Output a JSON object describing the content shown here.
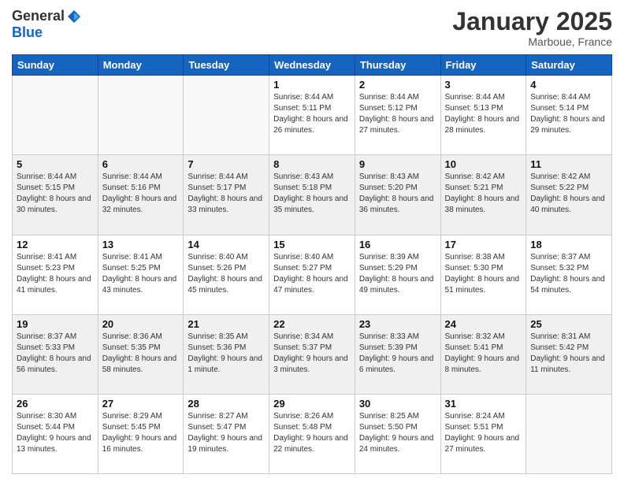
{
  "header": {
    "logo_general": "General",
    "logo_blue": "Blue",
    "month": "January 2025",
    "location": "Marboue, France"
  },
  "days_of_week": [
    "Sunday",
    "Monday",
    "Tuesday",
    "Wednesday",
    "Thursday",
    "Friday",
    "Saturday"
  ],
  "weeks": [
    [
      {
        "day": "",
        "info": ""
      },
      {
        "day": "",
        "info": ""
      },
      {
        "day": "",
        "info": ""
      },
      {
        "day": "1",
        "info": "Sunrise: 8:44 AM\nSunset: 5:11 PM\nDaylight: 8 hours and 26 minutes."
      },
      {
        "day": "2",
        "info": "Sunrise: 8:44 AM\nSunset: 5:12 PM\nDaylight: 8 hours and 27 minutes."
      },
      {
        "day": "3",
        "info": "Sunrise: 8:44 AM\nSunset: 5:13 PM\nDaylight: 8 hours and 28 minutes."
      },
      {
        "day": "4",
        "info": "Sunrise: 8:44 AM\nSunset: 5:14 PM\nDaylight: 8 hours and 29 minutes."
      }
    ],
    [
      {
        "day": "5",
        "info": "Sunrise: 8:44 AM\nSunset: 5:15 PM\nDaylight: 8 hours and 30 minutes."
      },
      {
        "day": "6",
        "info": "Sunrise: 8:44 AM\nSunset: 5:16 PM\nDaylight: 8 hours and 32 minutes."
      },
      {
        "day": "7",
        "info": "Sunrise: 8:44 AM\nSunset: 5:17 PM\nDaylight: 8 hours and 33 minutes."
      },
      {
        "day": "8",
        "info": "Sunrise: 8:43 AM\nSunset: 5:18 PM\nDaylight: 8 hours and 35 minutes."
      },
      {
        "day": "9",
        "info": "Sunrise: 8:43 AM\nSunset: 5:20 PM\nDaylight: 8 hours and 36 minutes."
      },
      {
        "day": "10",
        "info": "Sunrise: 8:42 AM\nSunset: 5:21 PM\nDaylight: 8 hours and 38 minutes."
      },
      {
        "day": "11",
        "info": "Sunrise: 8:42 AM\nSunset: 5:22 PM\nDaylight: 8 hours and 40 minutes."
      }
    ],
    [
      {
        "day": "12",
        "info": "Sunrise: 8:41 AM\nSunset: 5:23 PM\nDaylight: 8 hours and 41 minutes."
      },
      {
        "day": "13",
        "info": "Sunrise: 8:41 AM\nSunset: 5:25 PM\nDaylight: 8 hours and 43 minutes."
      },
      {
        "day": "14",
        "info": "Sunrise: 8:40 AM\nSunset: 5:26 PM\nDaylight: 8 hours and 45 minutes."
      },
      {
        "day": "15",
        "info": "Sunrise: 8:40 AM\nSunset: 5:27 PM\nDaylight: 8 hours and 47 minutes."
      },
      {
        "day": "16",
        "info": "Sunrise: 8:39 AM\nSunset: 5:29 PM\nDaylight: 8 hours and 49 minutes."
      },
      {
        "day": "17",
        "info": "Sunrise: 8:38 AM\nSunset: 5:30 PM\nDaylight: 8 hours and 51 minutes."
      },
      {
        "day": "18",
        "info": "Sunrise: 8:37 AM\nSunset: 5:32 PM\nDaylight: 8 hours and 54 minutes."
      }
    ],
    [
      {
        "day": "19",
        "info": "Sunrise: 8:37 AM\nSunset: 5:33 PM\nDaylight: 8 hours and 56 minutes."
      },
      {
        "day": "20",
        "info": "Sunrise: 8:36 AM\nSunset: 5:35 PM\nDaylight: 8 hours and 58 minutes."
      },
      {
        "day": "21",
        "info": "Sunrise: 8:35 AM\nSunset: 5:36 PM\nDaylight: 9 hours and 1 minute."
      },
      {
        "day": "22",
        "info": "Sunrise: 8:34 AM\nSunset: 5:37 PM\nDaylight: 9 hours and 3 minutes."
      },
      {
        "day": "23",
        "info": "Sunrise: 8:33 AM\nSunset: 5:39 PM\nDaylight: 9 hours and 6 minutes."
      },
      {
        "day": "24",
        "info": "Sunrise: 8:32 AM\nSunset: 5:41 PM\nDaylight: 9 hours and 8 minutes."
      },
      {
        "day": "25",
        "info": "Sunrise: 8:31 AM\nSunset: 5:42 PM\nDaylight: 9 hours and 11 minutes."
      }
    ],
    [
      {
        "day": "26",
        "info": "Sunrise: 8:30 AM\nSunset: 5:44 PM\nDaylight: 9 hours and 13 minutes."
      },
      {
        "day": "27",
        "info": "Sunrise: 8:29 AM\nSunset: 5:45 PM\nDaylight: 9 hours and 16 minutes."
      },
      {
        "day": "28",
        "info": "Sunrise: 8:27 AM\nSunset: 5:47 PM\nDaylight: 9 hours and 19 minutes."
      },
      {
        "day": "29",
        "info": "Sunrise: 8:26 AM\nSunset: 5:48 PM\nDaylight: 9 hours and 22 minutes."
      },
      {
        "day": "30",
        "info": "Sunrise: 8:25 AM\nSunset: 5:50 PM\nDaylight: 9 hours and 24 minutes."
      },
      {
        "day": "31",
        "info": "Sunrise: 8:24 AM\nSunset: 5:51 PM\nDaylight: 9 hours and 27 minutes."
      },
      {
        "day": "",
        "info": ""
      }
    ]
  ]
}
